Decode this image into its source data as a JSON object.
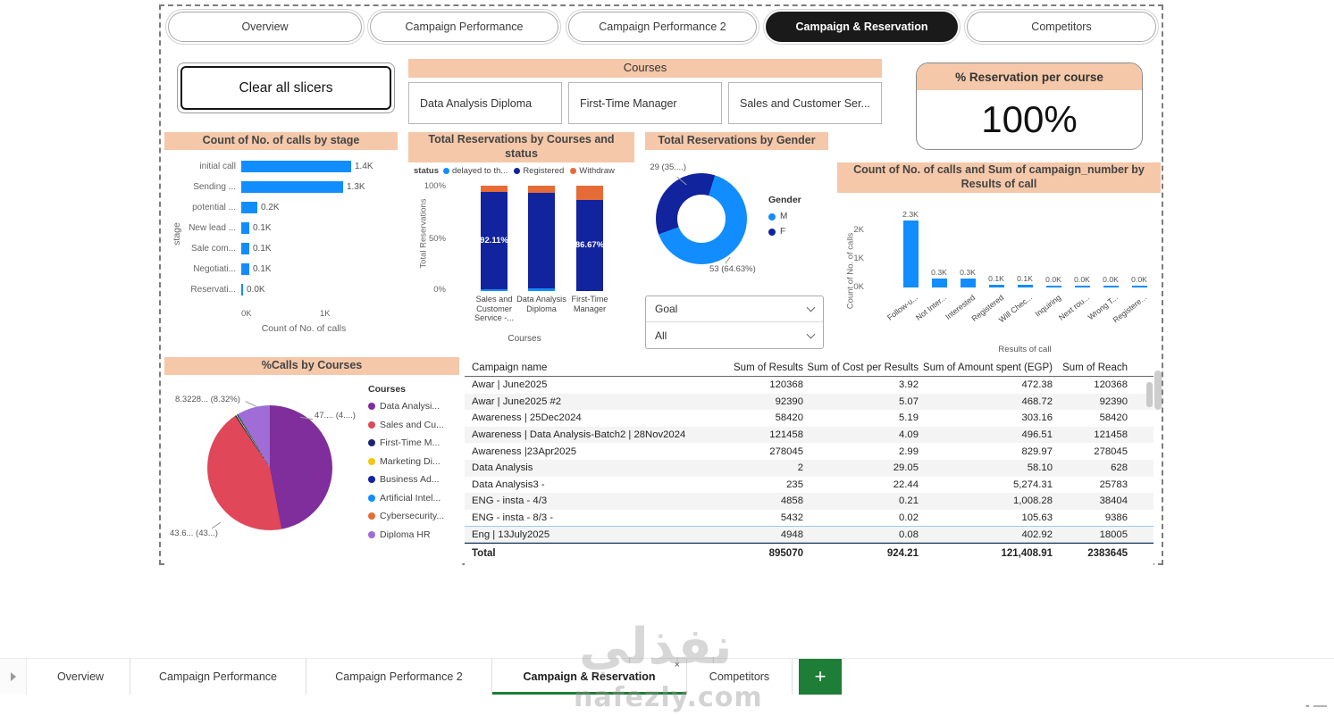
{
  "colors": {
    "header_fill": "#F4C8A9",
    "accent_blue": "#118DFF",
    "navy": "#12239E",
    "orange": "#E66C37",
    "active_tab_bg": "#1A1A1A",
    "green": "#1E7D36"
  },
  "top_tabs": {
    "items": [
      {
        "label": "Overview",
        "active": false
      },
      {
        "label": "Campaign Performance",
        "active": false
      },
      {
        "label": "Campaign Performance 2",
        "active": false
      },
      {
        "label": "Campaign & Reservation",
        "active": true
      },
      {
        "label": "Competitors",
        "active": false
      }
    ]
  },
  "clear_slicers_label": "Clear all slicers",
  "courses_slicer": {
    "title": "Courses",
    "options": [
      "Data Analysis Diploma",
      "First-Time Manager",
      "Sales and Customer Ser..."
    ]
  },
  "reservation_card": {
    "title": "% Reservation per course",
    "value": "100%"
  },
  "stage_chart": {
    "title": "Count of No. of calls by stage",
    "x_axis_title": "Count of No. of calls",
    "y_axis_title": "stage",
    "x_ticks": [
      "0K",
      "1K"
    ],
    "chart_data": {
      "type": "bar",
      "orientation": "horizontal",
      "categories": [
        "initial call",
        "Sending ...",
        "potential ...",
        "New lead ...",
        "Sale com...",
        "Negotiati...",
        "Reservati..."
      ],
      "values_k": [
        1.4,
        1.3,
        0.2,
        0.1,
        0.1,
        0.1,
        0.0
      ],
      "value_labels": [
        "1.4K",
        "1.3K",
        "0.2K",
        "0.1K",
        "0.1K",
        "0.1K",
        "0.0K"
      ],
      "bar_color": "#118DFF"
    }
  },
  "status_chart": {
    "title": "Total Reservations by Courses and status",
    "legend_title": "status",
    "legend": [
      {
        "label": "delayed to th...",
        "color": "#118DFF"
      },
      {
        "label": "Registered",
        "color": "#12239E"
      },
      {
        "label": "Withdraw",
        "color": "#E66C37"
      }
    ],
    "y_ticks": [
      "100%",
      "50%",
      "0%"
    ],
    "y_axis_title": "Total Reservations",
    "x_axis_title": "Courses",
    "chart_data": {
      "type": "bar",
      "stacked": true,
      "stacked_100": true,
      "categories": [
        "Sales and Customer Service -...",
        "Data Analysis Diploma",
        "First-Time Manager"
      ],
      "series": [
        {
          "name": "delayed to th...",
          "color": "#118DFF",
          "values": [
            2.0,
            2.5,
            0.0
          ]
        },
        {
          "name": "Registered",
          "color": "#12239E",
          "values": [
            92.11,
            90.5,
            86.67
          ],
          "labels": [
            "92.11%",
            "",
            "86.67%"
          ]
        },
        {
          "name": "Withdraw",
          "color": "#E66C37",
          "values": [
            5.89,
            7.0,
            13.33
          ]
        }
      ]
    }
  },
  "gender_chart": {
    "title": "Total Reservations by Gender",
    "legend_title": "Gender",
    "callout_f": "29 (35....)",
    "callout_m": "53 (64.63%)",
    "chart_data": {
      "type": "pie",
      "donut": true,
      "slices": [
        {
          "name": "M",
          "value": 53,
          "pct_label": "64.63%",
          "color": "#118DFF"
        },
        {
          "name": "F",
          "value": 29,
          "pct_label": "35....",
          "color": "#12239E"
        }
      ]
    }
  },
  "goal_slicer": {
    "title": "Goal",
    "value": "All"
  },
  "results_chart": {
    "title": "Count of No. of calls and Sum of campaign_number by Results of call",
    "y_ticks": [
      "2K",
      "1K",
      "0K"
    ],
    "y_axis_title": "Count of No. of calls",
    "x_axis_title": "Results of call",
    "chart_data": {
      "type": "bar",
      "categories": [
        "Follow-u...",
        "Not Inter...",
        "Interested",
        "Registered",
        "Will Chec...",
        "Inquiring",
        "Next rou...",
        "Wrong T...",
        "Registere..."
      ],
      "values_k": [
        2.3,
        0.3,
        0.3,
        0.1,
        0.1,
        0.0,
        0.0,
        0.0,
        0.0
      ],
      "value_labels": [
        "2.3K",
        "0.3K",
        "0.3K",
        "0.1K",
        "0.1K",
        "0.0K",
        "0.0K",
        "0.0K",
        "0.0K"
      ],
      "bar_color": "#118DFF"
    }
  },
  "calls_pie": {
    "title": "%Calls by Courses",
    "legend_title": "Courses",
    "legend": [
      {
        "label": "Data Analysi...",
        "color": "#7F2E9B"
      },
      {
        "label": "Sales and Cu...",
        "color": "#E04759"
      },
      {
        "label": "First-Time M...",
        "color": "#1C2670"
      },
      {
        "label": "Marketing Di...",
        "color": "#F2C80F"
      },
      {
        "label": "Business Ad...",
        "color": "#12239E"
      },
      {
        "label": "Artificial Intel...",
        "color": "#118DFF"
      },
      {
        "label": "Cybersecurity...",
        "color": "#E66C37"
      },
      {
        "label": "Diploma HR",
        "color": "#A06CD5"
      }
    ],
    "callouts": [
      {
        "text": "8.3228... (8.32%)"
      },
      {
        "text": "47.... (4....)"
      },
      {
        "text": "43.6... (43...)"
      }
    ],
    "chart_data": {
      "type": "pie",
      "slices": [
        {
          "name": "Data Analysi...",
          "value": 47.0,
          "color": "#7F2E9B"
        },
        {
          "name": "Sales and Cu...",
          "value": 43.6,
          "color": "#E04759"
        },
        {
          "name": "First-Time M...",
          "value": 0.3,
          "color": "#1C2670"
        },
        {
          "name": "Marketing Di...",
          "value": 0.25,
          "color": "#F2C80F"
        },
        {
          "name": "Business Ad...",
          "value": 0.2,
          "color": "#12239E"
        },
        {
          "name": "Artificial Intel...",
          "value": 0.2,
          "color": "#118DFF"
        },
        {
          "name": "Cybersecurity...",
          "value": 0.13,
          "color": "#E66C37"
        },
        {
          "name": "Diploma HR",
          "value": 8.32,
          "color": "#A06CD5"
        }
      ]
    }
  },
  "table": {
    "columns": [
      "Campaign name",
      "Sum of Results",
      "Sum of Cost per Results",
      "Sum of Amount spent (EGP)",
      "Sum of Reach"
    ],
    "rows": [
      [
        "Awar | June2025",
        "120368",
        "3.92",
        "472.38",
        "120368"
      ],
      [
        "Awar | June2025 #2",
        "92390",
        "5.07",
        "468.72",
        "92390"
      ],
      [
        "Awareness | 25Dec2024",
        "58420",
        "5.19",
        "303.16",
        "58420"
      ],
      [
        "Awareness | Data Analysis-Batch2 | 28Nov2024",
        "121458",
        "4.09",
        "496.51",
        "121458"
      ],
      [
        "Awareness |23Apr2025",
        "278045",
        "2.99",
        "829.97",
        "278045"
      ],
      [
        "Data Analysis",
        "2",
        "29.05",
        "58.10",
        "628"
      ],
      [
        "Data Analysis3 -",
        "235",
        "22.44",
        "5,274.31",
        "25783"
      ],
      [
        "ENG - insta - 4/3",
        "4858",
        "0.21",
        "1,008.28",
        "38404"
      ],
      [
        "ENG - insta - 8/3 -",
        "5432",
        "0.02",
        "105.63",
        "9386"
      ],
      [
        "Eng | 13July2025",
        "4948",
        "0.08",
        "402.92",
        "18005"
      ]
    ],
    "total_row": [
      "Total",
      "895070",
      "924.21",
      "121,408.91",
      "2383645"
    ],
    "highlighted_row_index": 9
  },
  "bottom_tabs": {
    "items": [
      {
        "label": "Overview",
        "active": false
      },
      {
        "label": "Campaign Performance",
        "active": false
      },
      {
        "label": "Campaign Performance 2",
        "active": false
      },
      {
        "label": "Campaign & Reservation",
        "active": true
      },
      {
        "label": "Competitors",
        "active": false
      }
    ],
    "add_button_label": "+",
    "close_icon": "×"
  },
  "watermark": {
    "arabic": "نفذلي",
    "latin": "nafezly.com"
  },
  "corner_marks": "- —"
}
